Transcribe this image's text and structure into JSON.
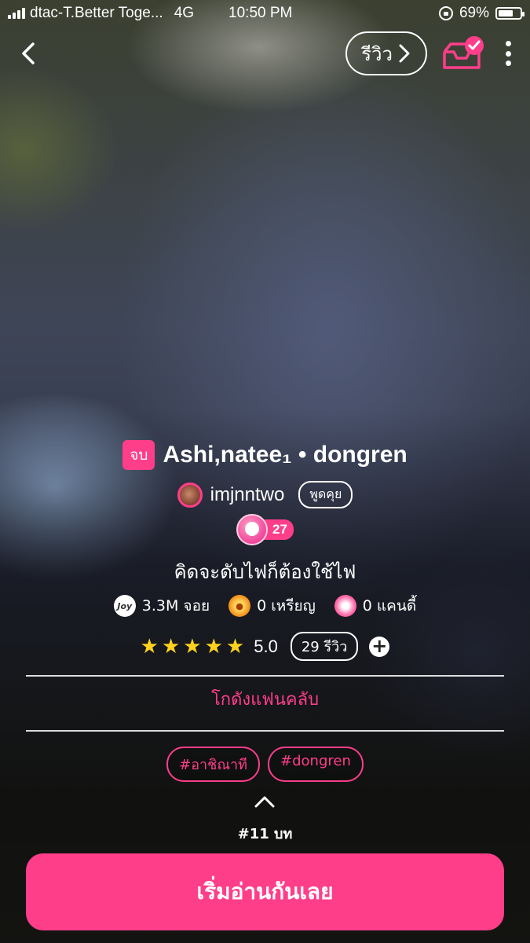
{
  "status_bar": {
    "carrier": "dtac-T.Better Toge...",
    "network": "4G",
    "time": "10:50 PM",
    "battery": "69%",
    "battery_level": 0.69
  },
  "nav": {
    "review_label": "รีวิว",
    "shelf_icon": "shelf-added-icon",
    "more_icon": "more-vertical-icon"
  },
  "story": {
    "end_badge": "จบ",
    "title": "Ashi,natee₁ • dongren",
    "author": "imjnntwo",
    "chat_label": "พูดคุย",
    "level": "27",
    "tagline": "คิดจะดับไฟก็ต้องใช้ไฟ"
  },
  "stats": {
    "joy_icon_text": "Joy",
    "views": "3.3M จอย",
    "coins": "0 เหรียญ",
    "candies": "0 แคนดี้"
  },
  "rating": {
    "stars": 5,
    "value": "5.0",
    "reviews": "29 รีวิว",
    "plus": "+"
  },
  "fanclub_label": "โกดังแฟนคลับ",
  "tags": [
    "#อาชิณาที",
    "#dongren"
  ],
  "episodes": "#11 บท",
  "start_button": "เริ่มอ่านกันเลย",
  "colors": {
    "accent": "#ff3e8a",
    "star": "#ffd21e"
  }
}
